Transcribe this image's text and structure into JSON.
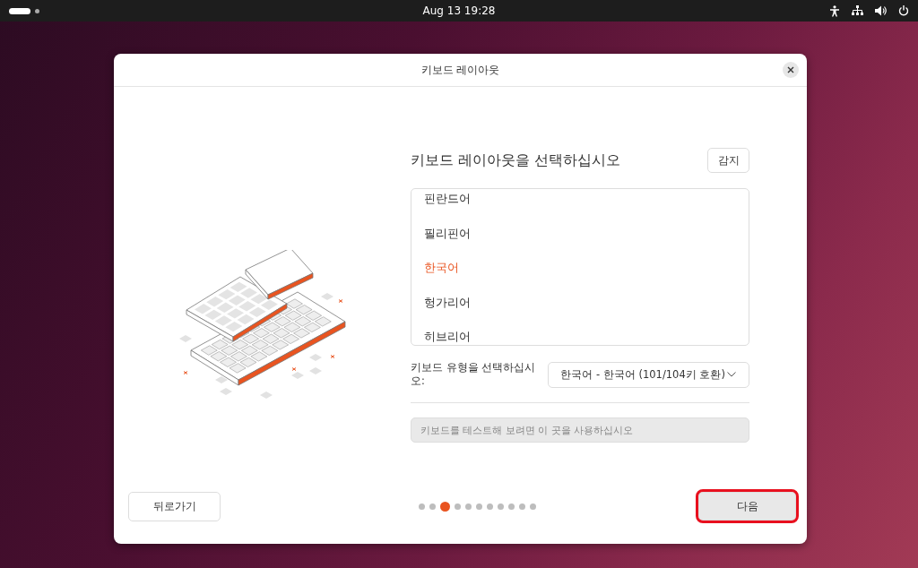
{
  "top_bar": {
    "clock": "Aug 13  19:28"
  },
  "dialog": {
    "title": "키보드 레이아웃",
    "heading": "키보드 레이아웃을 선택하십시오",
    "detect_button": "감지",
    "layouts": [
      {
        "label": "핀란드어",
        "selected": false
      },
      {
        "label": "필리핀어",
        "selected": false
      },
      {
        "label": "한국어",
        "selected": true
      },
      {
        "label": "헝가리어",
        "selected": false
      },
      {
        "label": "히브리어",
        "selected": false
      }
    ],
    "variant_label": "키보드 유형을 선택하십시오:",
    "variant_value": "한국어 - 한국어 (101/104키 호환)",
    "test_field": {
      "placeholder": "키보드를 테스트해 보려면 이 곳을 사용하십시오"
    },
    "back_button": "뒤로가기",
    "steps": [
      {
        "selected": false
      },
      {
        "selected": false
      },
      {
        "selected": true
      },
      {
        "selected": false
      },
      {
        "selected": false
      },
      {
        "selected": false
      },
      {
        "selected": false
      },
      {
        "selected": false
      },
      {
        "selected": false
      },
      {
        "selected": false
      },
      {
        "selected": false
      }
    ],
    "next_button": {
      "label": "다음",
      "highlighted": true
    }
  }
}
